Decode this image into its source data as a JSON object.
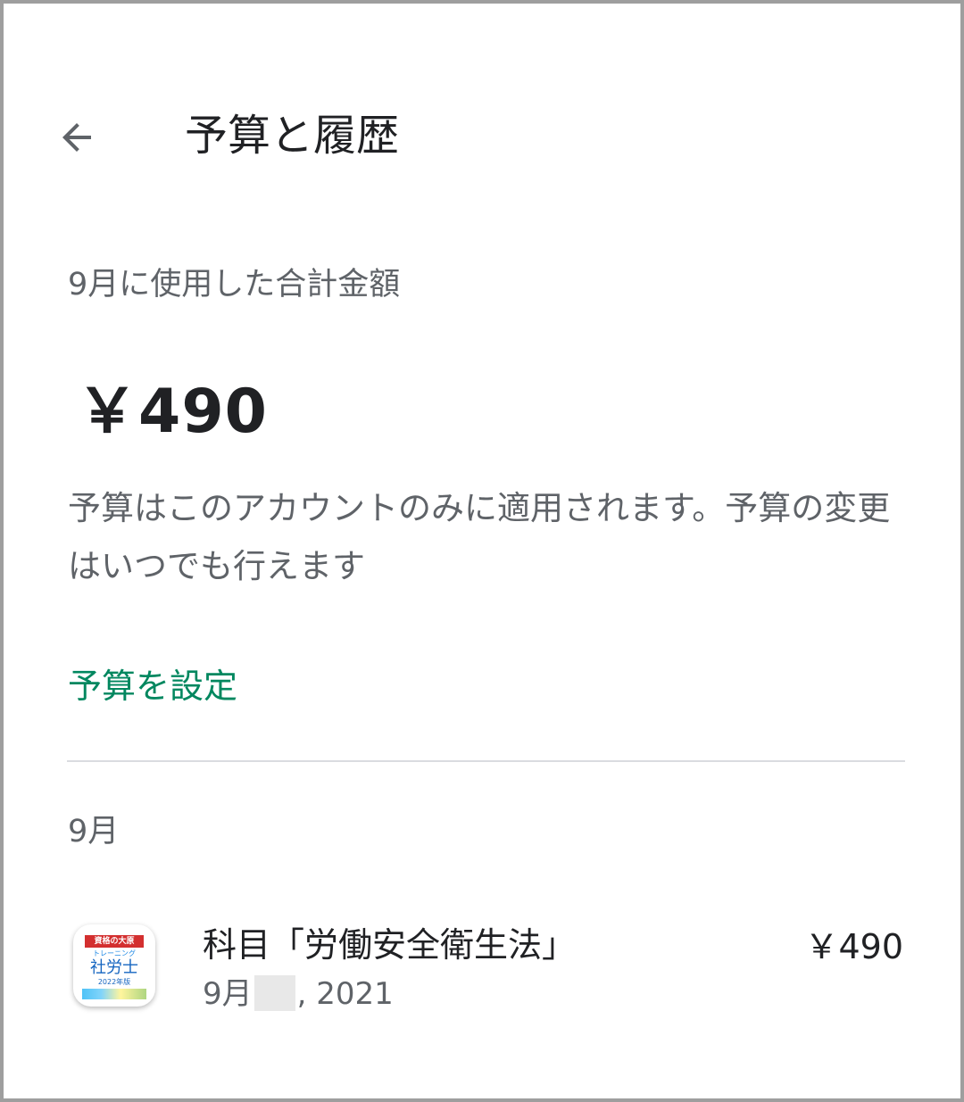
{
  "header": {
    "back_icon": "arrow-back-icon",
    "title": "予算と履歴"
  },
  "summary": {
    "label": "9月に使用した合計金額",
    "total": "￥490",
    "note": "予算はこのアカウントのみに適用されます。予算の変更はいつでも行えます",
    "set_budget_label": "予算を設定"
  },
  "history": {
    "month_label": "9月",
    "items": [
      {
        "icon": {
          "banner": "資格の大原",
          "sub": "トレーニング",
          "main": "社労士",
          "year": "2022年版"
        },
        "title": "科目「労働安全衛生法」",
        "date_prefix": "9月",
        "date_suffix": ", 2021",
        "price": "￥490"
      }
    ]
  },
  "colors": {
    "accent": "#01875f",
    "text_primary": "#202124",
    "text_secondary": "#5f6368",
    "divider": "#dadce0"
  }
}
